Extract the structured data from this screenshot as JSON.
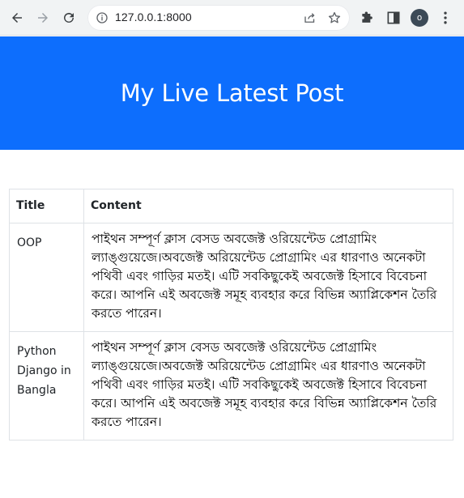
{
  "browser": {
    "url": "127.0.0.1:8000",
    "profile_initial": "o",
    "icons": {
      "back": "arrow-left-icon",
      "forward": "arrow-right-icon",
      "reload": "reload-icon",
      "site_info": "info-icon",
      "share": "share-icon",
      "bookmark": "star-icon",
      "extensions": "puzzle-icon",
      "side_panel": "side-panel-icon",
      "menu": "kebab-menu-icon"
    }
  },
  "header": {
    "title": "My Live Latest Post",
    "background": "#0d6efd"
  },
  "table": {
    "columns": [
      "Title",
      "Content"
    ],
    "rows": [
      {
        "title": "OOP",
        "content": "পাইথন সম্পূর্ণ ক্লাস বেসড অবজেক্ট ওরিয়েন্টেড প্রোগ্রামিং ল্যাঙ্গুয়েজে।অবজেক্ট অরিয়েন্টেড প্রোগ্রামিং এর ধারণাও অনেকটা পথিবী এবং গাড়ির মতই। এটি সবকিছুকেই অবজেক্ট হিসাবে বিবেচনা করে। আপনি এই অবজেক্ট সমূহ ব্যবহার করে বিভিন্ন অ্যাপ্লিকেশন তৈরি করতে পারেন।"
      },
      {
        "title": "Python Django in Bangla",
        "content": "পাইথন সম্পূর্ণ ক্লাস বেসড অবজেক্ট ওরিয়েন্টেড প্রোগ্রামিং ল্যাঙ্গুয়েজে।অবজেক্ট অরিয়েন্টেড প্রোগ্রামিং এর ধারণাও অনেকটা পথিবী এবং গাড়ির মতই। এটি সবকিছুকেই অবজেক্ট হিসাবে বিবেচনা করে। আপনি এই অবজেক্ট সমূহ ব্যবহার করে বিভিন্ন অ্যাপ্লিকেশন তৈরি করতে পারেন।"
      }
    ]
  }
}
